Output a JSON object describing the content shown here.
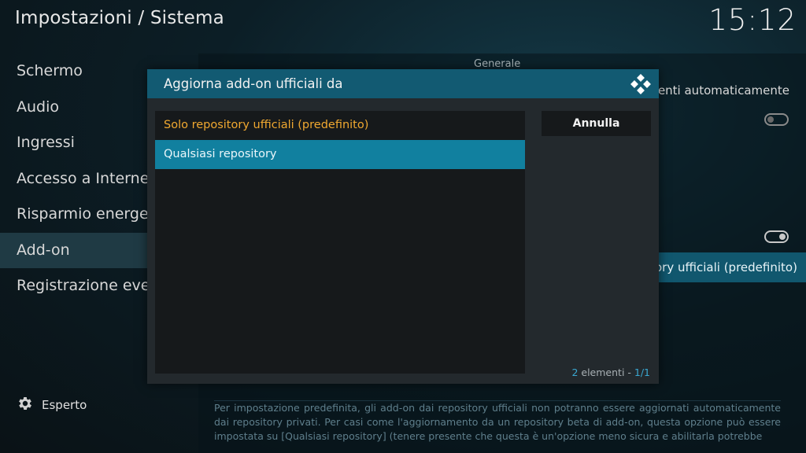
{
  "header": {
    "title": "Impostazioni / Sistema",
    "clock": "15:12"
  },
  "sidebar": {
    "items": [
      {
        "label": "Schermo"
      },
      {
        "label": "Audio"
      },
      {
        "label": "Ingressi"
      },
      {
        "label": "Accesso a Internet"
      },
      {
        "label": "Risparmio energetico"
      },
      {
        "label": "Add-on",
        "active": true
      },
      {
        "label": "Registrazione eventi"
      }
    ],
    "expert_label": "Esperto"
  },
  "content": {
    "section_title": "Generale",
    "row1_label": "menti automaticamente",
    "selected_row_value": "ory ufficiali (predefinito)",
    "description": "Per impostazione predefinita, gli add-on dai repository ufficiali non potranno essere aggiornati automaticamente dai repository privati. Per casi come l'aggiornamento da un repository beta di add-on, questa opzione può essere impostata su [Qualsiasi repository] (tenere presente che questa è un'opzione meno sicura e abilitarla potrebbe"
  },
  "dialog": {
    "title": "Aggiorna add-on ufficiali da",
    "options": [
      {
        "label": "Solo repository ufficiali (predefinito)",
        "state": "current"
      },
      {
        "label": "Qualsiasi repository",
        "state": "focused"
      }
    ],
    "cancel_label": "Annulla",
    "count_number": "2",
    "count_text": " elementi - ",
    "page": "1/1"
  },
  "colors": {
    "accent": "#125a72",
    "focus": "#11809f",
    "current_item": "#f0a830"
  }
}
